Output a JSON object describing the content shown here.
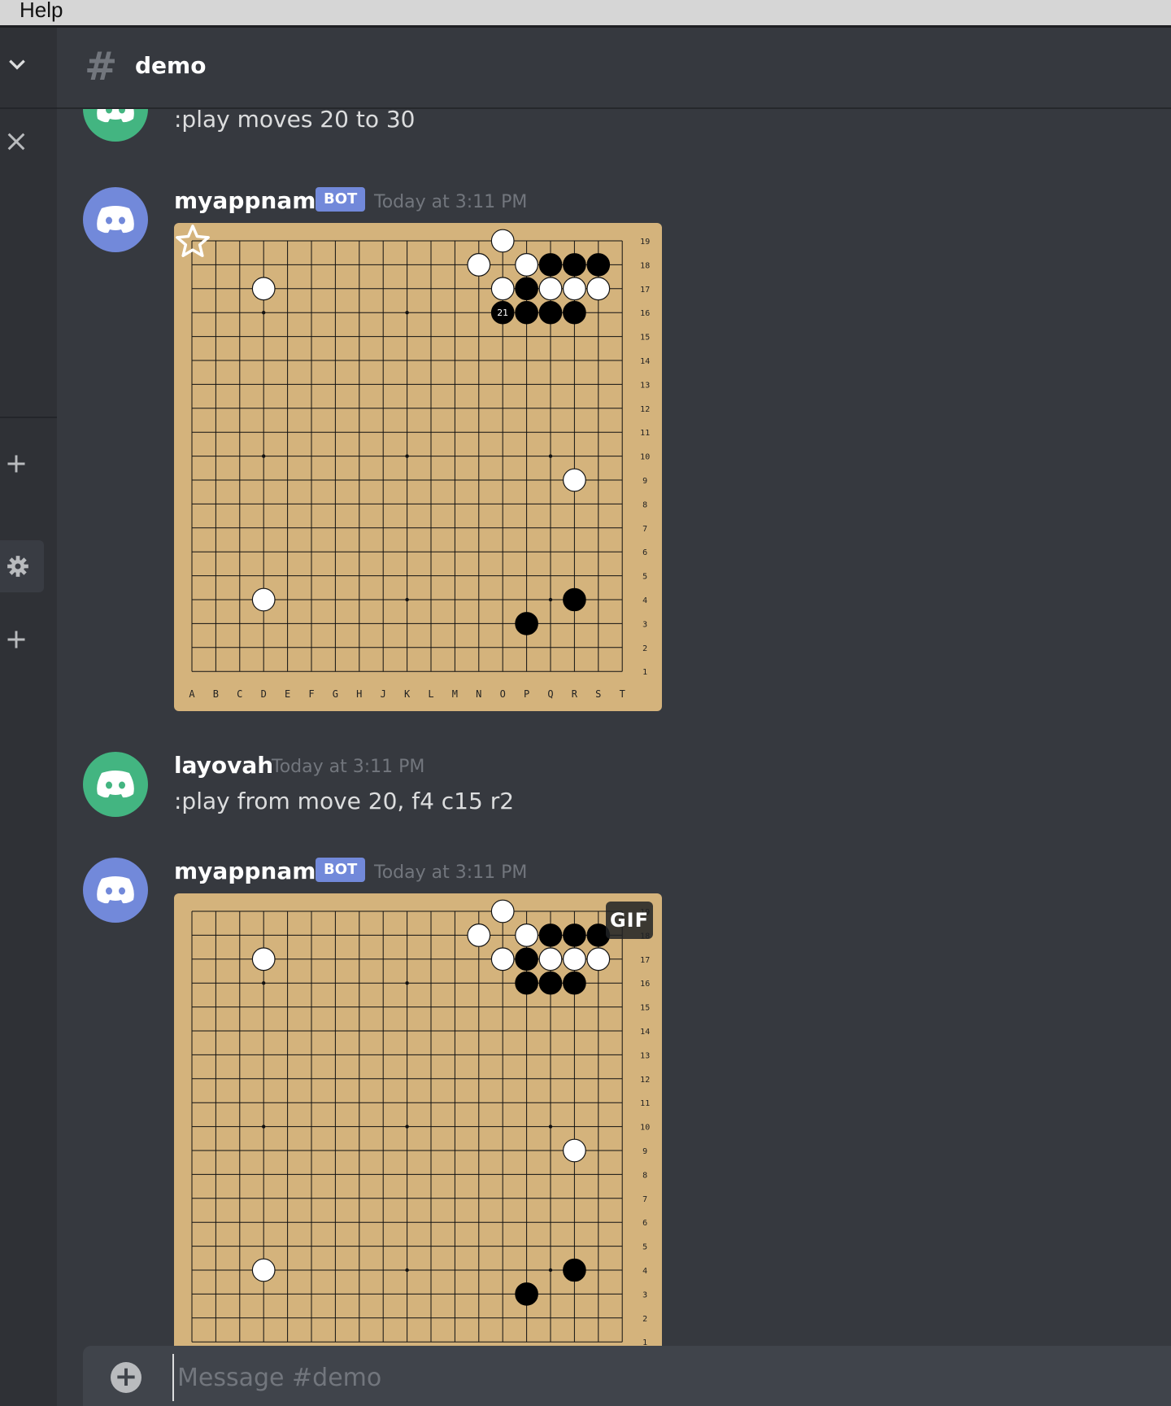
{
  "menubar": {
    "help": "Help"
  },
  "channel": {
    "hash": "#",
    "name": "demo"
  },
  "messages": [
    {
      "id": "m0",
      "text": ":play moves 20 to 30"
    },
    {
      "id": "m1",
      "author": "myappname",
      "bot_tag": "BOT",
      "timestamp": "Today at 3:11 PM",
      "embed": "board1"
    },
    {
      "id": "m2",
      "author": "layovah",
      "timestamp": "Today at 3:11 PM",
      "text": ":play from move 20, f4 c15 r2"
    },
    {
      "id": "m3",
      "author": "myappname",
      "bot_tag": "BOT",
      "timestamp": "Today at 3:11 PM",
      "embed": "board2"
    }
  ],
  "board": {
    "size": 19,
    "col_labels": [
      "A",
      "B",
      "C",
      "D",
      "E",
      "F",
      "G",
      "H",
      "J",
      "K",
      "L",
      "M",
      "N",
      "O",
      "P",
      "Q",
      "R",
      "S",
      "T"
    ],
    "row_labels": [
      "19",
      "18",
      "17",
      "16",
      "15",
      "14",
      "13",
      "12",
      "11",
      "10",
      "9",
      "8",
      "7",
      "6",
      "5",
      "4",
      "3",
      "2",
      "1"
    ],
    "star_points": [
      "D16",
      "K16",
      "Q16",
      "D10",
      "K10",
      "Q10",
      "D4",
      "K4",
      "Q4"
    ],
    "board_color": "#d4b37c"
  },
  "board1": {
    "white": [
      "O19",
      "N18",
      "P18",
      "O17",
      "Q17",
      "R17",
      "S17",
      "D17",
      "R9",
      "D4"
    ],
    "black": [
      "Q18",
      "R18",
      "S18",
      "P17",
      "O16",
      "P16",
      "Q16",
      "R16",
      "R4",
      "P3"
    ],
    "numbered": [
      {
        "point": "O16",
        "label": "21"
      }
    ],
    "overlay_icon": "star-icon"
  },
  "board2": {
    "white": [
      "O19",
      "N18",
      "P18",
      "O17",
      "Q17",
      "R17",
      "S17",
      "D17",
      "R9",
      "D4"
    ],
    "black": [
      "Q18",
      "R18",
      "S18",
      "P17",
      "P16",
      "Q16",
      "R16",
      "R4",
      "P3"
    ],
    "gif_label": "GIF"
  },
  "composer": {
    "placeholder": "Message #demo",
    "attach_icon": "plus-circle-icon"
  }
}
